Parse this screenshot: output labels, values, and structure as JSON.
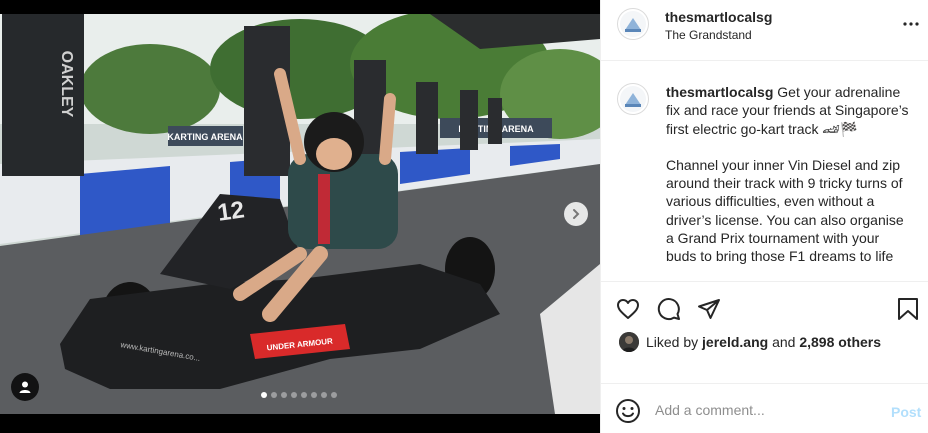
{
  "post": {
    "username": "thesmartlocalsg",
    "location": "The Grandstand",
    "caption_p1": "Get your adrenaline fix and race your friends at Singapore’s first electric go-kart track 🏎🏁",
    "caption_p2": "Channel your inner Vin Diesel and zip around their track with 9 tricky turns of various difficulties, even without a driver’s license. You can also organise a Grand Prix tournament with your buds to bring those F1 dreams to life"
  },
  "likes": {
    "prefix": "Liked by",
    "user": "jereld.ang",
    "joiner": "and",
    "others": "2,898 others"
  },
  "comment": {
    "placeholder": "Add a comment...",
    "post_label": "Post"
  },
  "media": {
    "slide_count": 8,
    "active_slide": 1,
    "banner_left": "KARTING ARENA",
    "banner_right": "KARTING ARENA",
    "pillar_brand": "OAKLEY",
    "kart_number": "12",
    "kart_url": "www.kartingarena.co...",
    "kart_sponsor": "UNDER ARMOUR"
  },
  "icons": {
    "more": "more-horizontal-icon",
    "next": "chevron-right-icon",
    "tag": "user-tag-icon",
    "like": "heart-icon",
    "comment": "comment-icon",
    "share": "paper-plane-icon",
    "save": "bookmark-icon",
    "emoji": "smiley-icon"
  }
}
